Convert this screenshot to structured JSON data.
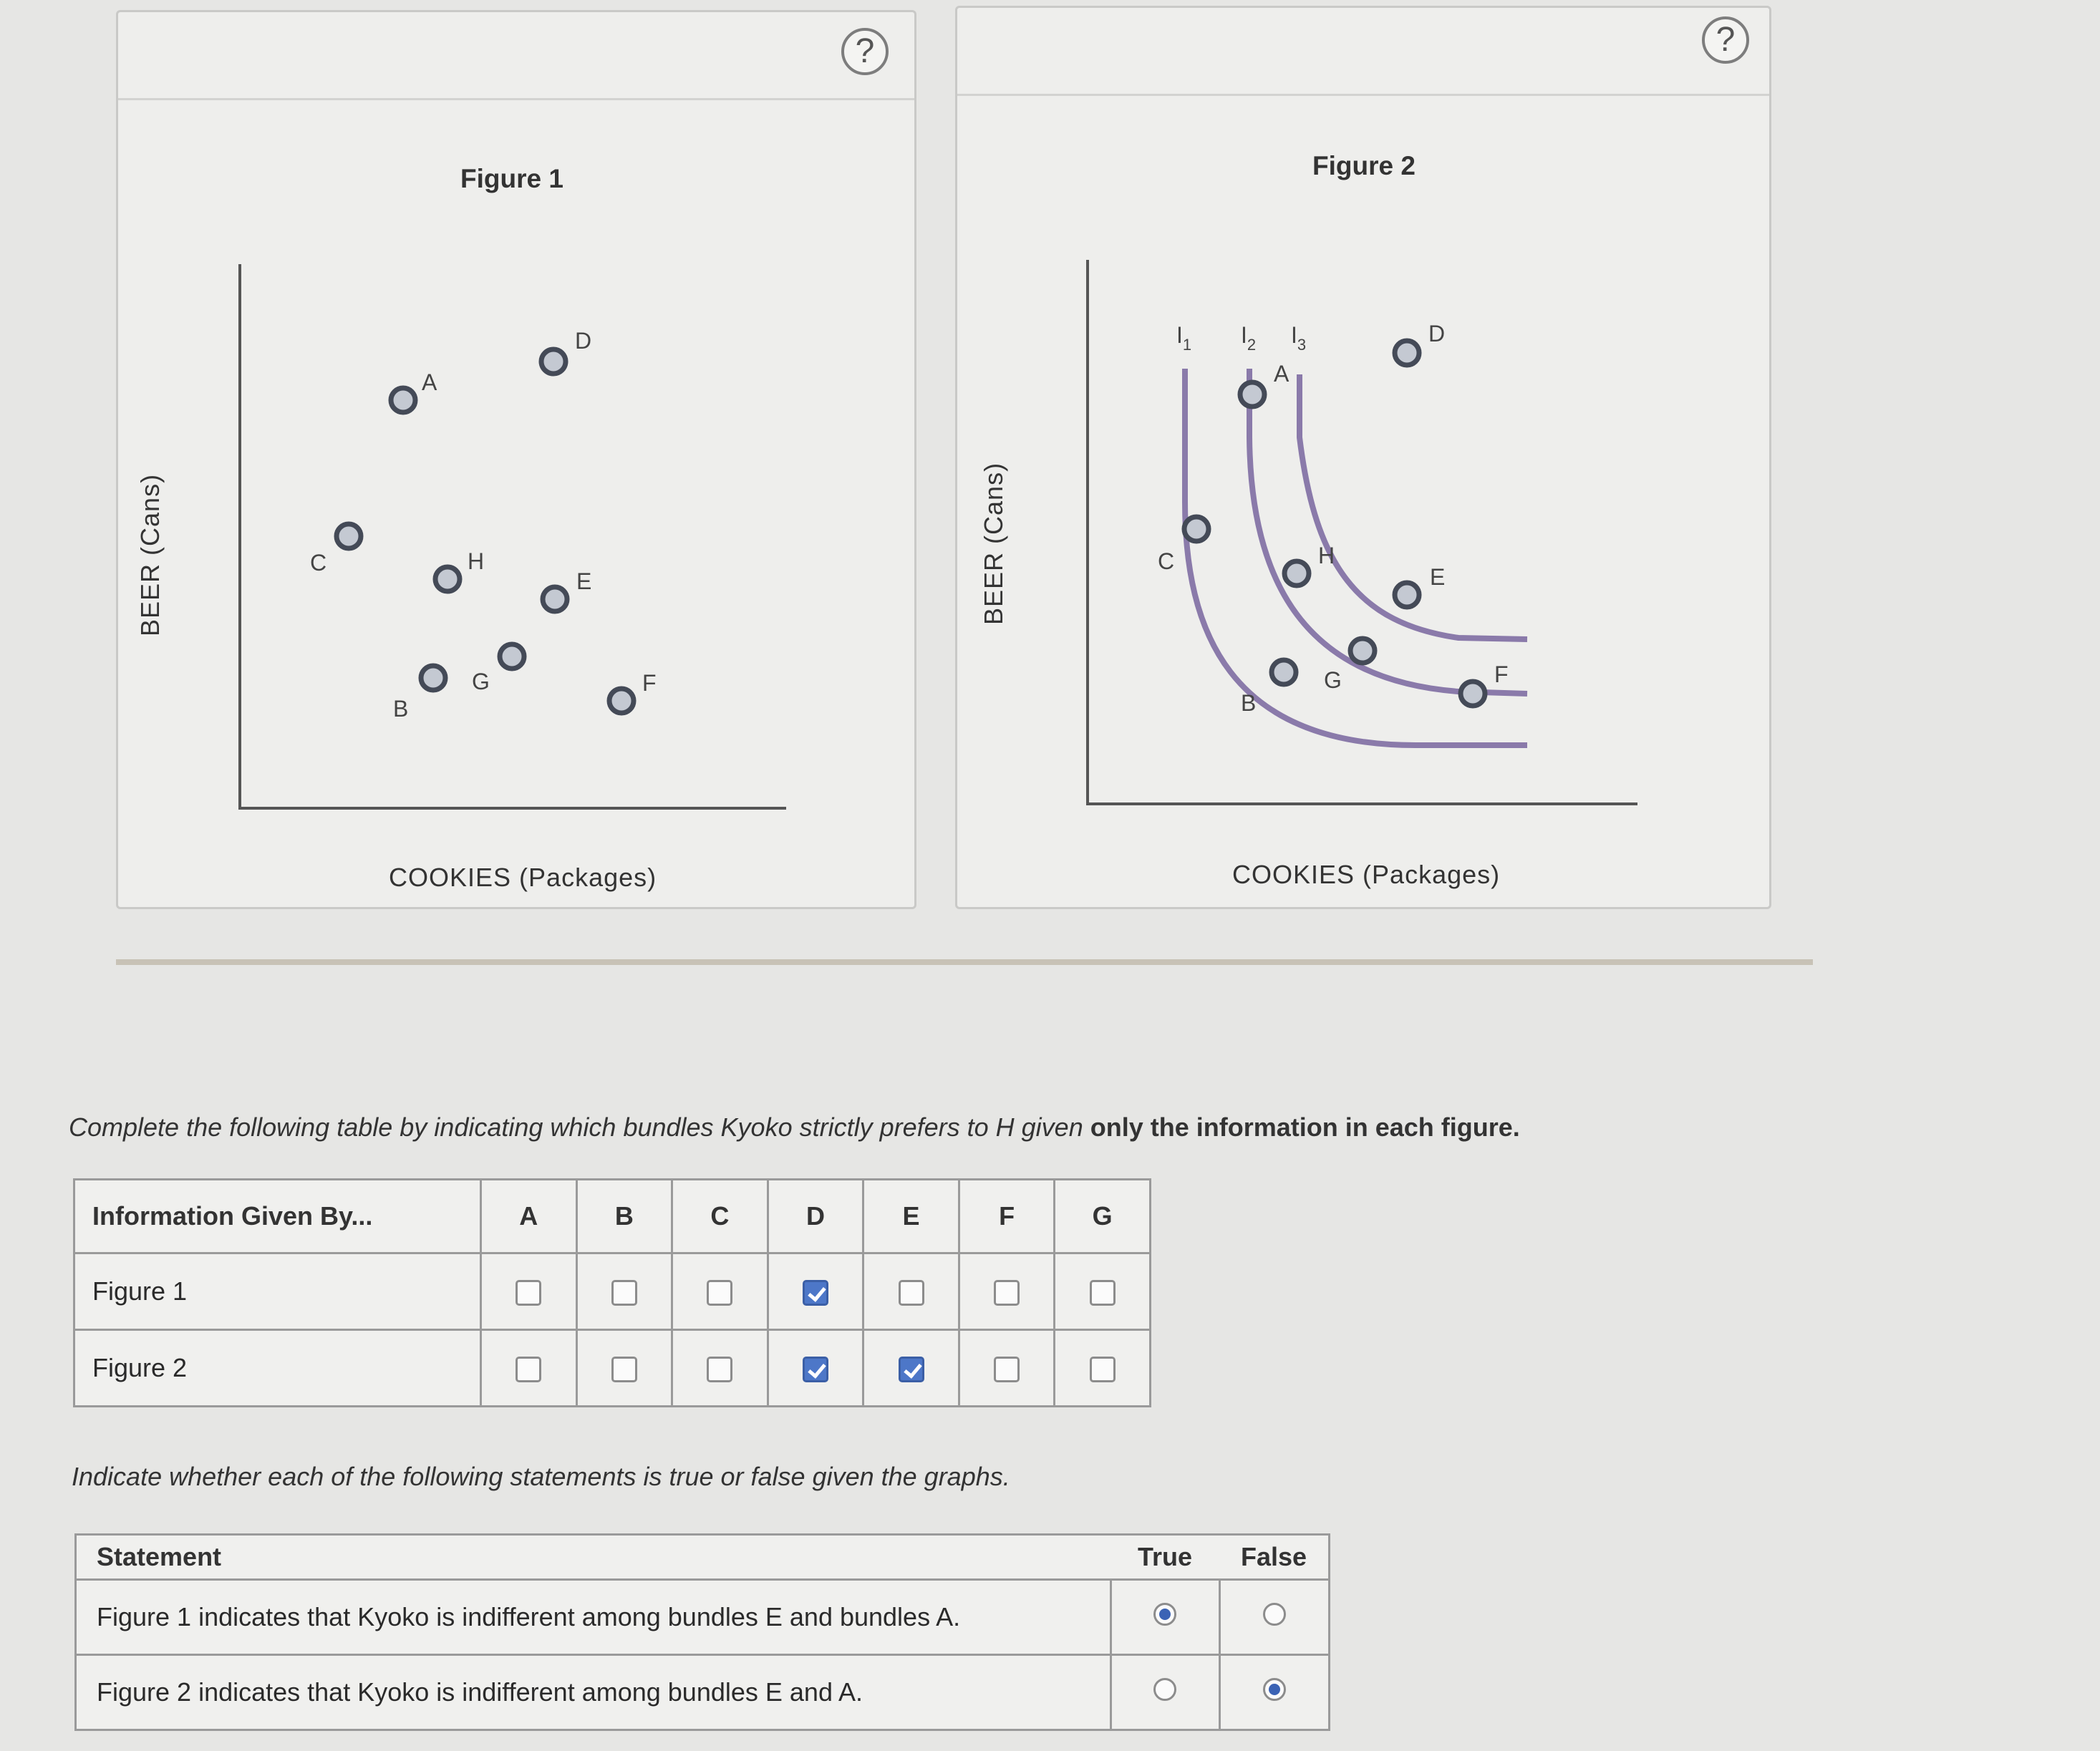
{
  "figure1": {
    "title": "Figure 1",
    "help": "?",
    "ylabel": "BEER (Cans)",
    "xlabel": "COOKIES (Packages)",
    "points": [
      "A",
      "D",
      "C",
      "H",
      "E",
      "G",
      "B",
      "F"
    ]
  },
  "figure2": {
    "title": "Figure 2",
    "help": "?",
    "ylabel": "BEER (Cans)",
    "xlabel": "COOKIES (Packages)",
    "curves": [
      {
        "label": "I",
        "sub": "1"
      },
      {
        "label": "I",
        "sub": "2"
      },
      {
        "label": "I",
        "sub": "3"
      }
    ],
    "points": [
      "A",
      "D",
      "C",
      "H",
      "E",
      "B",
      "G",
      "F"
    ]
  },
  "instruction1": {
    "text": "Complete the following table by indicating which bundles Kyoko strictly prefers to H given ",
    "bold": "only the information in each figure."
  },
  "table1": {
    "header": "Information Given By...",
    "columns": [
      "A",
      "B",
      "C",
      "D",
      "E",
      "F",
      "G"
    ],
    "rows": [
      {
        "label": "Figure 1",
        "checked": [
          false,
          false,
          false,
          true,
          false,
          false,
          false
        ]
      },
      {
        "label": "Figure 2",
        "checked": [
          false,
          false,
          false,
          true,
          true,
          false,
          false
        ]
      }
    ]
  },
  "instruction2": "Indicate whether each of the following statements is true or false given the graphs.",
  "table2": {
    "header_statement": "Statement",
    "header_true": "True",
    "header_false": "False",
    "rows": [
      {
        "statement": "Figure 1 indicates that Kyoko is indifferent among bundles E and bundles A.",
        "selected": "true"
      },
      {
        "statement": "Figure 2 indicates that Kyoko is indifferent among bundles E and A.",
        "selected": "false"
      }
    ]
  }
}
